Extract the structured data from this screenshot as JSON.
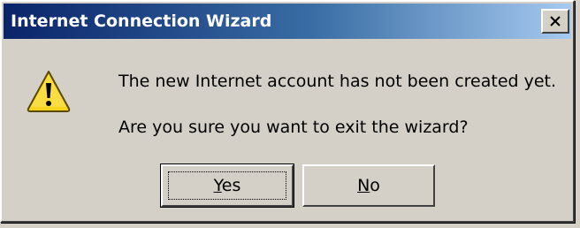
{
  "window": {
    "title": "Internet Connection Wizard",
    "close_label": "Close"
  },
  "message": {
    "line1": "The new Internet account has not been created yet.",
    "line2": "Are you sure you want to exit the wizard?",
    "icon": "warning-icon"
  },
  "buttons": {
    "yes": {
      "accel": "Y",
      "rest": "es",
      "default": true
    },
    "no": {
      "accel": "N",
      "rest": "o",
      "default": false
    }
  },
  "colors": {
    "title_start": "#0a246a",
    "title_end": "#a6caf0",
    "face": "#d4d0c8",
    "warning_yellow": "#f7d51e"
  }
}
